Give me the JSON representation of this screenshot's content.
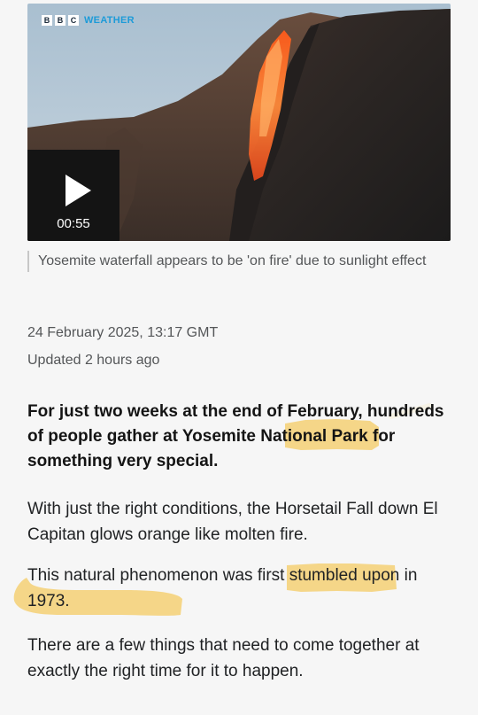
{
  "video": {
    "brand_letters": [
      "B",
      "B",
      "C"
    ],
    "brand_word": "WEATHER",
    "duration": "00:55",
    "play_icon": "play-icon"
  },
  "caption": "Yosemite waterfall appears to be 'on fire' due to sunlight effect",
  "published": "24 February 2025, 13:17 GMT",
  "updated": "Updated 2 hours ago",
  "lede": "For just two weeks at the end of February, hundreds of people gather at Yosemite National Park for something very special.",
  "paragraphs": [
    "With just the right conditions, the Horsetail Fall down El Capitan glows orange like molten fire.",
    "This natural phenomenon was first stumbled upon in 1973.",
    "There are a few things that need to come together at exactly the right time for it to happen."
  ],
  "colors": {
    "highlight": "#f5c95a",
    "brand_blue": "#1d9bd8",
    "caption_bar": "#c7c7c7"
  }
}
